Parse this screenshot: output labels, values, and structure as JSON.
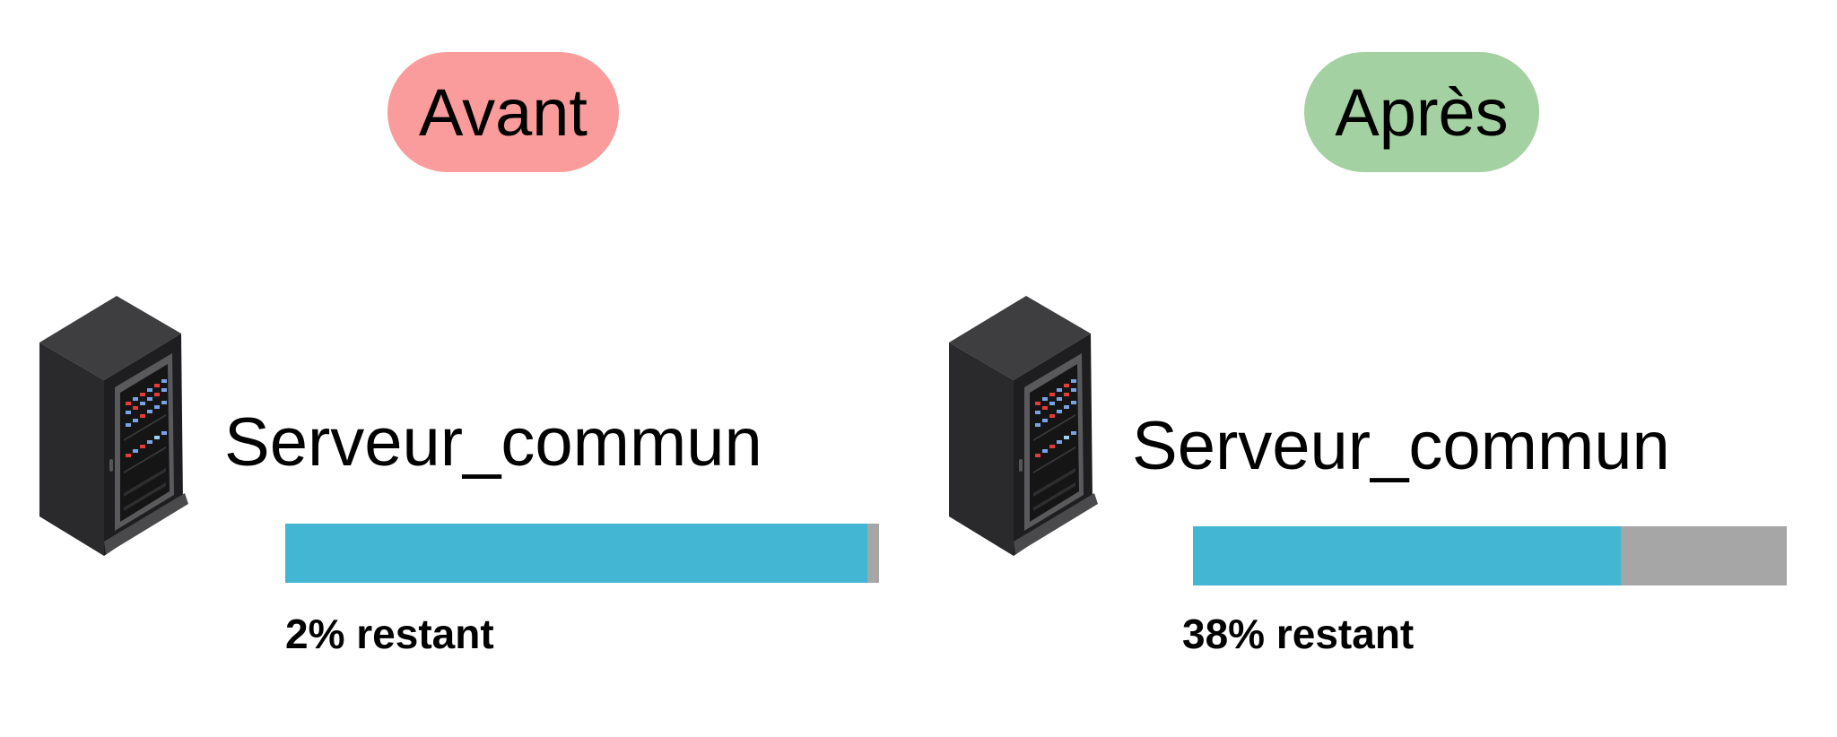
{
  "colors": {
    "before_pill": "#fa9c9c",
    "after_pill": "#a4d1a1",
    "used": "#42b6d3",
    "free": "#a6a6a6"
  },
  "before": {
    "label": "Avant",
    "icon": "server-rack-icon",
    "server_name": "Serveur_commun",
    "remaining_fraction": 0.02,
    "remaining_label": "2% restant"
  },
  "after": {
    "label": "Après",
    "icon": "server-rack-icon",
    "server_name": "Serveur_commun",
    "remaining_fraction": 0.28,
    "remaining_label": "38% restant"
  }
}
